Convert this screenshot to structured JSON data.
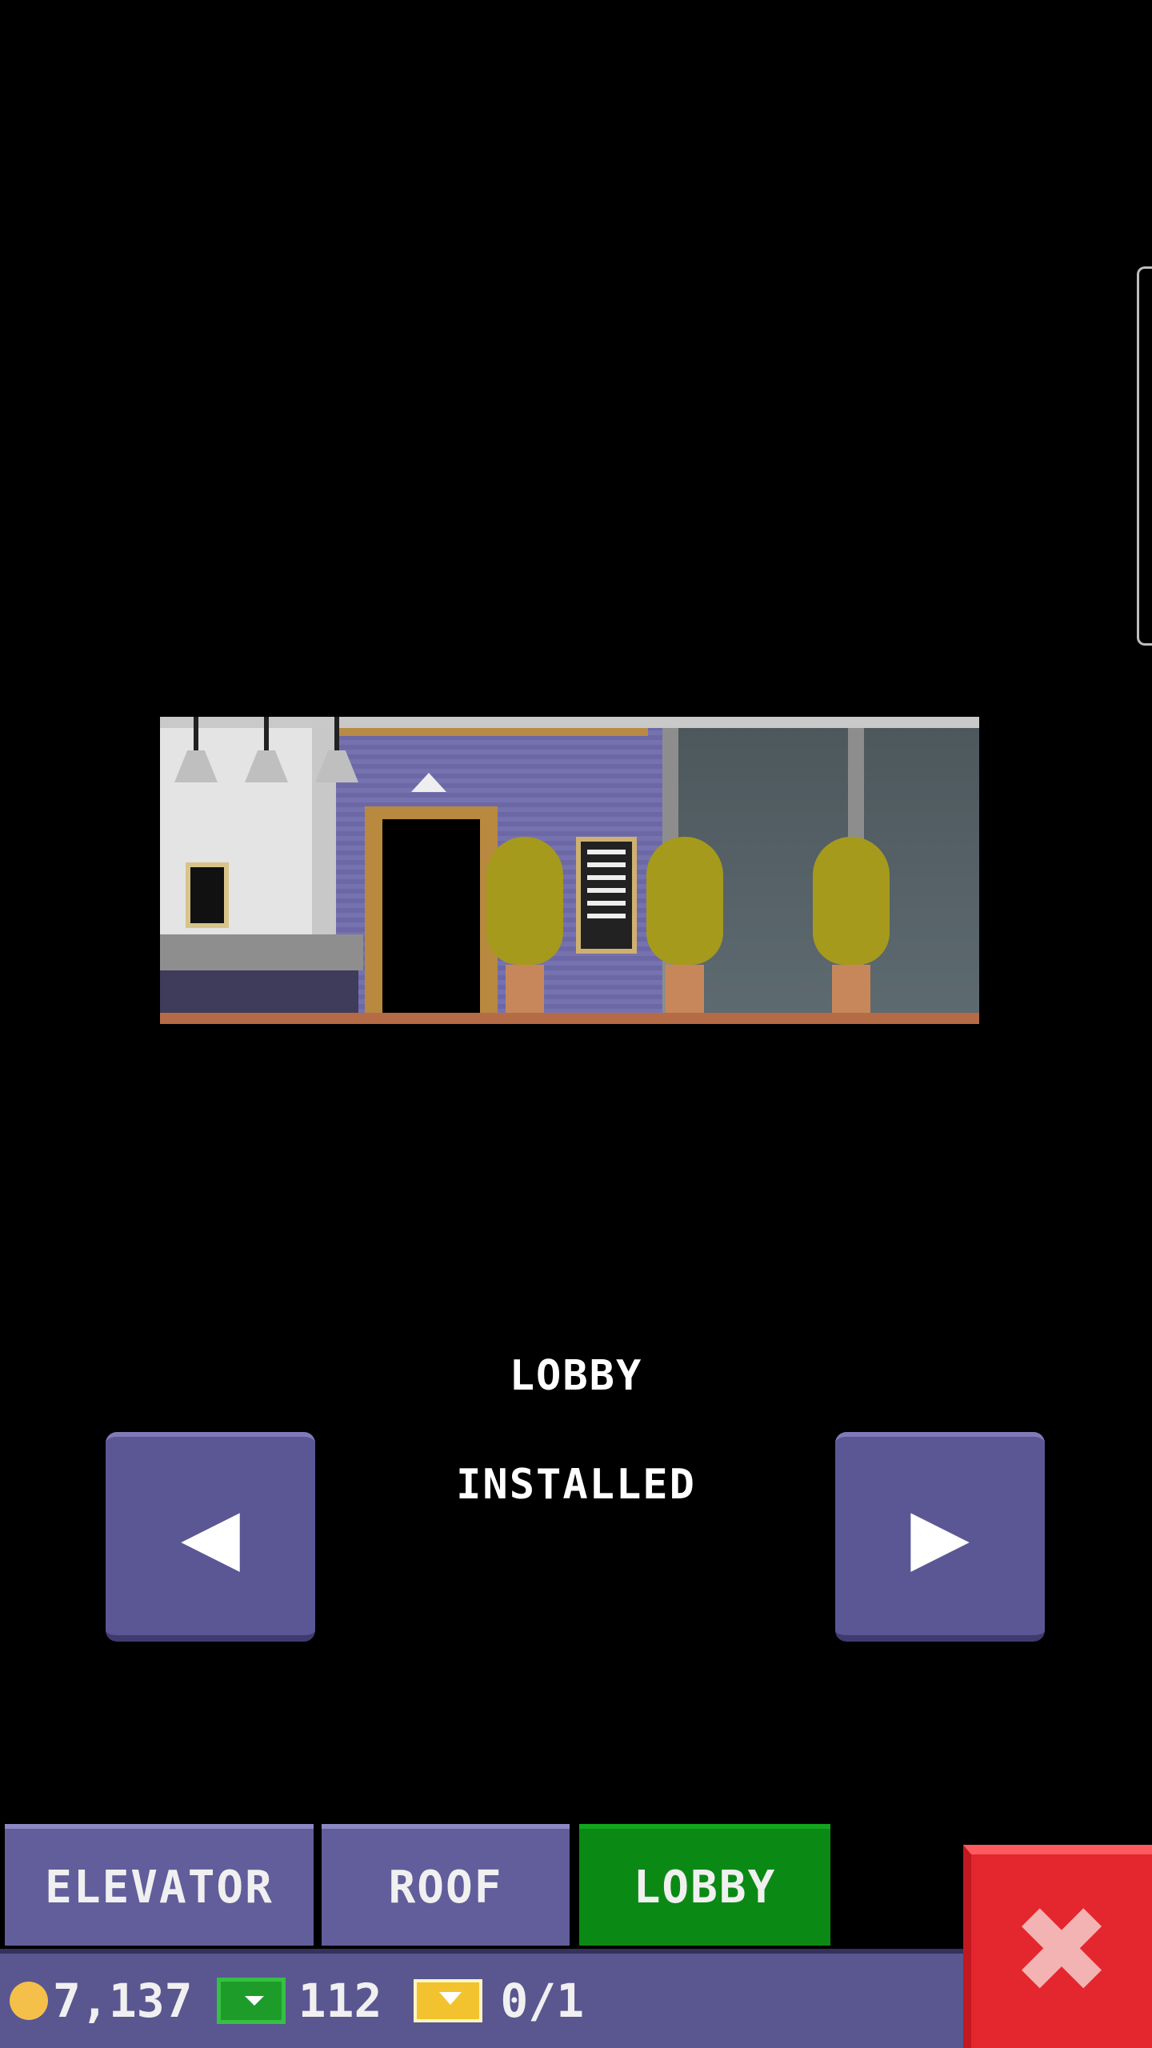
{
  "preview": {
    "name": "lobby-preview-image"
  },
  "item": {
    "title": "LOBBY",
    "status": "INSTALLED"
  },
  "nav": {
    "prev_glyph": "◀",
    "next_glyph": "▶"
  },
  "tabs": [
    {
      "label": "ELEVATOR",
      "active": false
    },
    {
      "label": "ROOF",
      "active": false
    },
    {
      "label": "LOBBY",
      "active": true
    }
  ],
  "currency": {
    "coins": "7,137",
    "bux": "112",
    "tickets": "0/1"
  },
  "close": {
    "glyph": "✖"
  },
  "colors": {
    "panel": "#5b5694",
    "active_tab": "#0a8a14",
    "close": "#e4262e",
    "coin": "#f5c04a",
    "bux": "#1e9c2a",
    "ticket": "#f2c32e"
  }
}
